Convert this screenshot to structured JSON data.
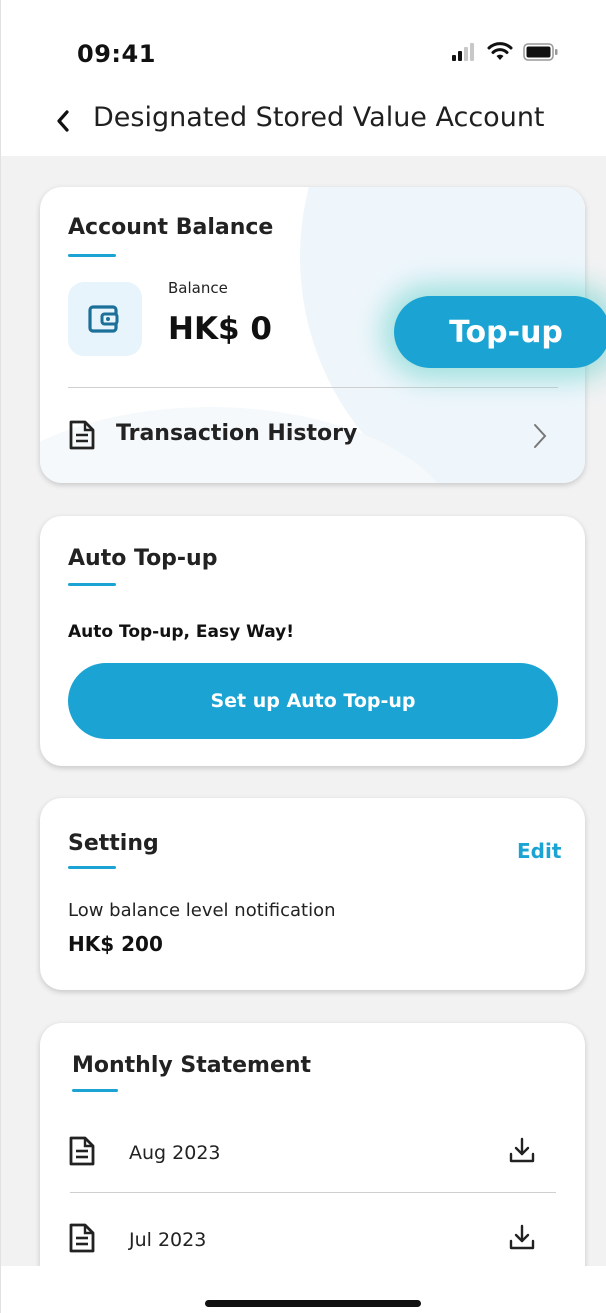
{
  "status_bar": {
    "time": "09:41"
  },
  "header": {
    "title": "Designated Stored Value Account"
  },
  "account_balance": {
    "title": "Account Balance",
    "balance_label": "Balance",
    "balance_value": "HK$ 0",
    "topup_label": "Top-up",
    "transaction_history_label": "Transaction History"
  },
  "auto_topup": {
    "title": "Auto Top-up",
    "subtitle": "Auto Top-up, Easy Way!",
    "button_label": "Set up Auto Top-up"
  },
  "setting": {
    "title": "Setting",
    "edit_label": "Edit",
    "notification_label": "Low balance level notification",
    "notification_value": "HK$ 200"
  },
  "monthly_statement": {
    "title": "Monthly Statement",
    "items": [
      {
        "month": "Aug 2023"
      },
      {
        "month": "Jul 2023"
      }
    ]
  },
  "colors": {
    "accent": "#1ba4d3",
    "background": "#f2f2f3",
    "card": "#ffffff",
    "glow": "#46c8be"
  },
  "icons": {
    "back": "chevron-left-icon",
    "wallet": "wallet-icon",
    "document": "document-icon",
    "chevron": "chevron-right-icon",
    "download": "download-icon",
    "signal": "signal-icon",
    "wifi": "wifi-icon",
    "battery": "battery-icon"
  }
}
